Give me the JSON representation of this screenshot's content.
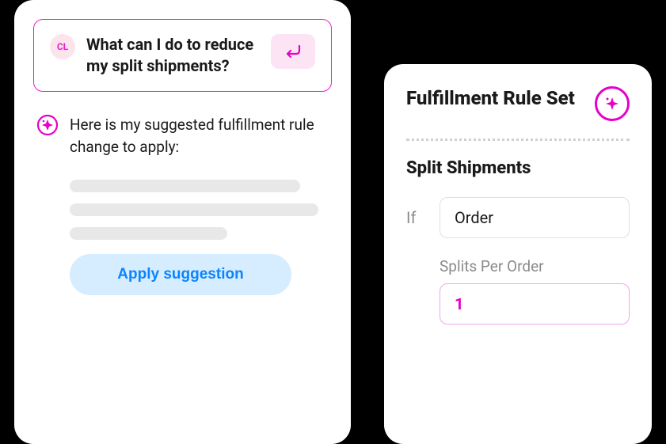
{
  "chat": {
    "user_initials": "CL",
    "query": "What can I do to reduce my split shipments?",
    "response": "Here is my suggested fulfillment rule change to apply:",
    "apply_button_label": "Apply suggestion"
  },
  "rule": {
    "title": "Fulfillment Rule Set",
    "section_title": "Split Shipments",
    "condition_label": "If",
    "condition_value": "Order",
    "field_label": "Splits Per Order",
    "field_value": "1"
  },
  "colors": {
    "accent": "#e600c8",
    "primary_action": "#0a84ff"
  }
}
